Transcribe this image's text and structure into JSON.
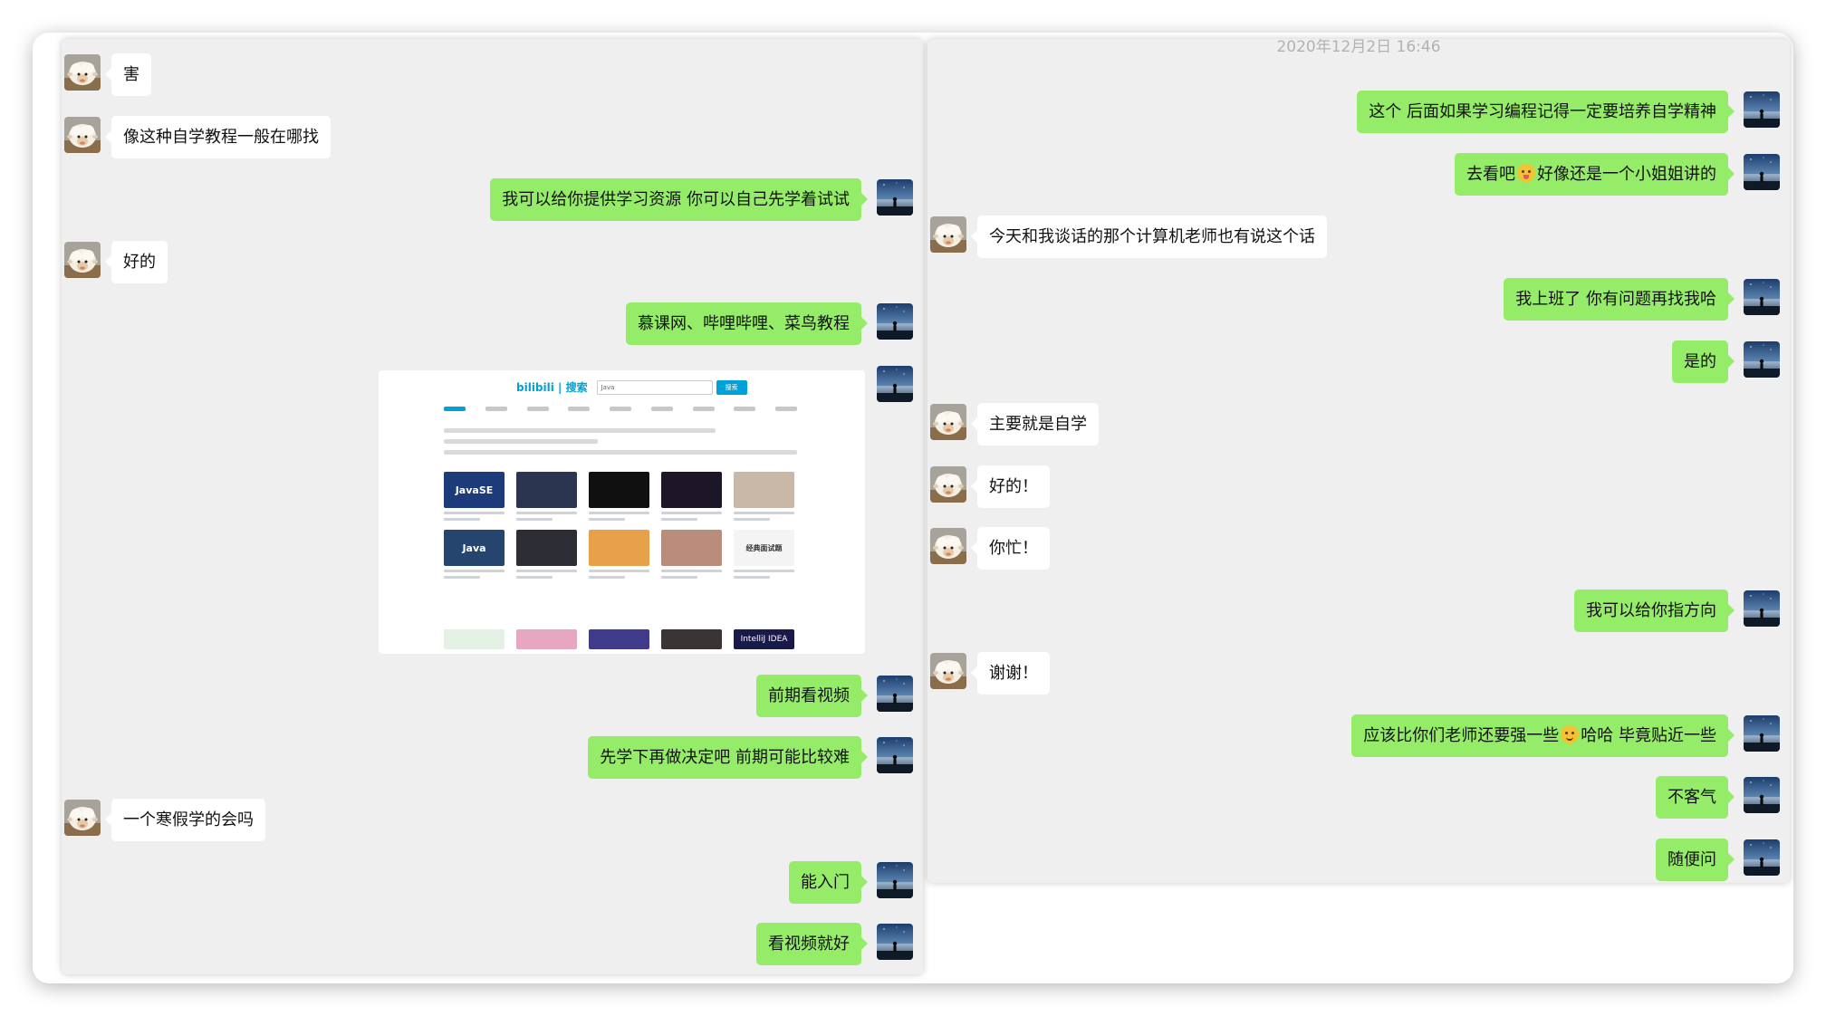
{
  "left": {
    "messages": [
      {
        "side": "in",
        "text": "害"
      },
      {
        "side": "in",
        "text": "像这种自学教程一般在哪找"
      },
      {
        "side": "out",
        "text": "我可以给你提供学习资源 你可以自己先学着试试"
      },
      {
        "side": "in",
        "text": "好的"
      },
      {
        "side": "out",
        "text": "慕课网、哔哩哔哩、菜鸟教程"
      },
      {
        "side": "out",
        "text": "前期看视频"
      },
      {
        "side": "out",
        "text": "先学下再做决定吧 前期可能比较难"
      },
      {
        "side": "in",
        "text": "一个寒假学的会吗"
      },
      {
        "side": "out",
        "text": "能入门"
      },
      {
        "side": "out",
        "text": "看视频就好"
      }
    ],
    "image": {
      "logo": "bilibili | 搜索",
      "search_value": "Java",
      "search_button": "搜索",
      "video_titles": [
        "JavaSE",
        "Java"
      ],
      "bottom_title": "IntelliJ IDEA",
      "card_label": "经典面试题"
    }
  },
  "right": {
    "timestamp": "2020年12月2日 16:46",
    "messages": [
      {
        "side": "out",
        "text": "这个 后面如果学习编程记得一定要培养自学精神"
      },
      {
        "side": "out",
        "pre": "去看吧",
        "post": "好像还是一个小姐姐讲的"
      },
      {
        "side": "in",
        "text": "今天和我谈话的那个计算机老师也有说这个话"
      },
      {
        "side": "out",
        "text": "我上班了 你有问题再找我哈"
      },
      {
        "side": "out",
        "text": "是的"
      },
      {
        "side": "in",
        "text": "主要就是自学"
      },
      {
        "side": "in",
        "text": "好的！"
      },
      {
        "side": "in",
        "text": "你忙！"
      },
      {
        "side": "out",
        "text": "我可以给你指方向"
      },
      {
        "side": "in",
        "text": "谢谢！"
      },
      {
        "side": "out",
        "pre": "应该比你们老师还要强一些",
        "post": "哈哈 毕竟贴近一些"
      },
      {
        "side": "out",
        "text": "不客气"
      },
      {
        "side": "out",
        "text": "随便问"
      }
    ]
  },
  "colors": {
    "bubble_out": "#95ec69",
    "bubble_in": "#ffffff",
    "panel_bg": "#efefef"
  }
}
